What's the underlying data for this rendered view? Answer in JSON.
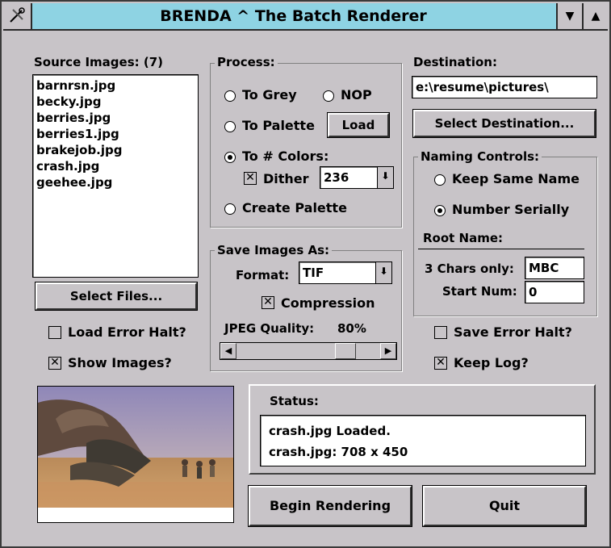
{
  "window": {
    "title": "BRENDA ^ The Batch Renderer",
    "min_glyph": "▼",
    "max_glyph": "▲"
  },
  "source": {
    "label": "Source Images: (7)",
    "files": [
      "barnrsn.jpg",
      "becky.jpg",
      "berries.jpg",
      "berries1.jpg",
      "brakejob.jpg",
      "crash.jpg",
      "geehee.jpg"
    ],
    "select_button": "Select Files..."
  },
  "options_left": {
    "load_error_halt": {
      "label": "Load Error Halt?",
      "checked": false
    },
    "show_images": {
      "label": "Show Images?",
      "checked": true
    }
  },
  "process": {
    "label": "Process:",
    "to_grey": "To Grey",
    "nop": "NOP",
    "to_palette": "To Palette",
    "load_button": "Load",
    "to_colors": "To # Colors:",
    "dither_label": "Dither",
    "dither_checked": true,
    "colors_value": "236",
    "create_palette": "Create Palette",
    "selected": "to_colors"
  },
  "save_as": {
    "label": "Save Images As:",
    "format_label": "Format:",
    "format_value": "TIF",
    "compression_label": "Compression",
    "compression_checked": true,
    "jpeg_quality_label": "JPEG Quality:",
    "jpeg_quality_value": "80%",
    "quality_fraction": 0.8
  },
  "destination": {
    "label": "Destination:",
    "path": "e:\\resume\\pictures\\",
    "select_button": "Select Destination..."
  },
  "naming": {
    "label": "Naming Controls:",
    "keep_same_name": "Keep Same Name",
    "number_serially": "Number Serially",
    "selected": "number_serially",
    "root_name_label": "Root Name:",
    "chars_only_label": "3 Chars only:",
    "chars_value": "MBC",
    "start_num_label": "Start Num:",
    "start_num_value": "0"
  },
  "options_right": {
    "save_error_halt": {
      "label": "Save Error Halt?",
      "checked": false
    },
    "keep_log": {
      "label": "Keep Log?",
      "checked": true
    }
  },
  "status": {
    "label": "Status:",
    "lines": [
      "crash.jpg Loaded.",
      "crash.jpg: 708 x 450"
    ]
  },
  "actions": {
    "begin": "Begin Rendering",
    "quit": "Quit"
  },
  "icons": {
    "system": "tools-icon",
    "minimize": "chevron-down-icon",
    "maximize": "chevron-up-icon"
  },
  "colors": {
    "titlebar": "#8ed3e3",
    "face": "#c8c4c8"
  }
}
